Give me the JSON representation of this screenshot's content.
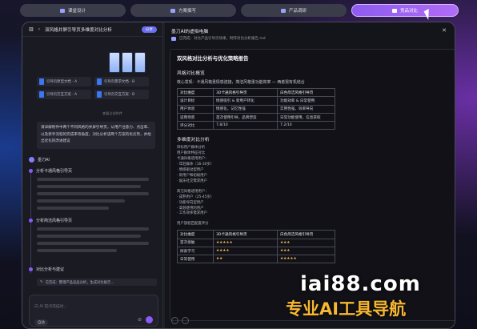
{
  "topnav": {
    "tabs": [
      {
        "label": "课堂设计",
        "icon": "pen-icon"
      },
      {
        "label": "方案撰写",
        "icon": "doc-icon"
      },
      {
        "label": "产品调研",
        "icon": "grid-icon"
      },
      {
        "label": "竞品对比",
        "icon": "compare-icon",
        "active": true
      }
    ]
  },
  "chat": {
    "title": "双风格并屏引导页多维度对比分析",
    "badge": "分享",
    "files": [
      "引导页原型文档 - A",
      "引导页需求文档 - B",
      "引导页交互方案 - A",
      "引导页交互方案 - B"
    ],
    "files_note": "查看全部附件",
    "request": "请详解附件中两个不同风格的并屏引导页，从用户注意力、点击率、以及新手流程的完成率等角度，对比分析该两个方案的优劣势，并给出优化的改进建议",
    "bot_name": "墨刀AI",
    "steps": [
      "分析卡通风格引导页",
      "分析简洁风格引导页",
      "对比分析与建议"
    ],
    "tool_label": "已完成：整理产品竞品分析，生成对比报告...",
    "input_placeholder": "向 AI 提问或描述...",
    "model": "自动"
  },
  "doc": {
    "panel_title": "墨刀AI的虚拟电脑",
    "panel_sub": "已完成：对比产品引导页效果，制作对比分析报告.md",
    "title": "双风格对比分析与优化策略报告",
    "sec1": "风格对比概览",
    "core": "核心发现：卡通风格重情感连接，简洁风格重功能效率 — 两者需有机结合",
    "t1_head": [
      "对比维度",
      "3D卡通风格引导页",
      "白色简洁风格引导页"
    ],
    "t1_rows": [
      [
        "设计目标",
        "情感吸引 & 新用户转化",
        "功能效率 & 日常使用"
      ],
      [
        "用户体验",
        "情感化，记忆性强",
        "实用性强，效率导向"
      ],
      [
        "适用场景",
        "首次使用引导，品牌塑造",
        "日常功能使用，信息获取"
      ],
      [
        "评分对比",
        "7.8/10",
        "7.2/10"
      ]
    ],
    "sec2": "多维度对比分析",
    "p_list": [
      "目标用户群体分析",
      "用户群体特征对比",
      "卡通风格适用用户：",
      "· 年轻群体（16-30岁）",
      "· 情感驱动型用户",
      "· 新用户和初级用户",
      "· 娱乐社交需求用户",
      "",
      "简洁风格适用用户：",
      "· 成熟用户（25-45岁）",
      "· 功能导向型用户",
      "· 高频使用的用户",
      "· 工作效率需求用户",
      "",
      "用户旅程匹配度评分"
    ],
    "t2_head": [
      "对比维度",
      "3D卡通风格引导页",
      "白色简洁风格引导页"
    ],
    "t2_rows": [
      [
        "首次接触",
        "★★★★★",
        "★★★"
      ],
      [
        "探索学习",
        "★★★★",
        "★★★"
      ],
      [
        "日常使用",
        "★★",
        "★★★★★"
      ]
    ]
  },
  "watermark": {
    "site": "iai88.com",
    "slogan": "专业AI工具导航"
  }
}
